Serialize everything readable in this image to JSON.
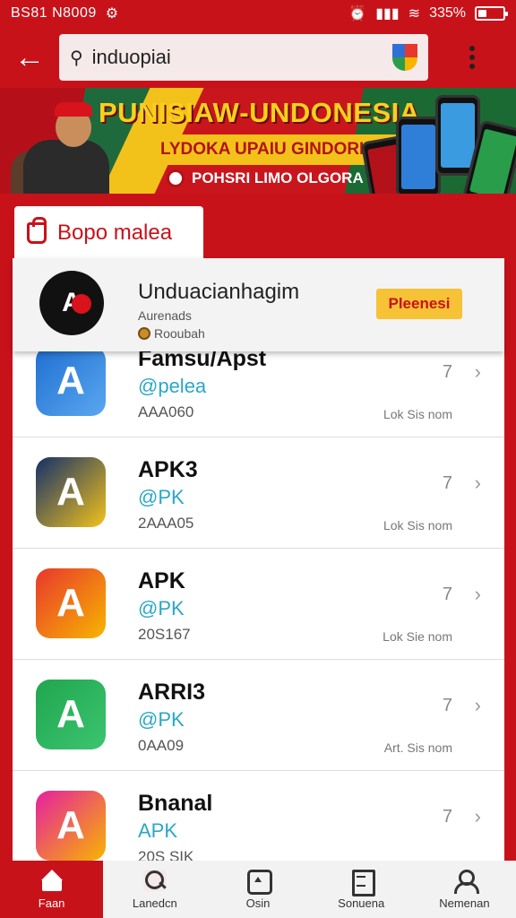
{
  "status_bar": {
    "time": "BS81 N8009",
    "battery": "335%",
    "battery_level": 0.33
  },
  "header": {
    "search_query": "induopiai",
    "back_icon": "arrow-left-icon",
    "menu_icon": "more-vertical-icon"
  },
  "banner": {
    "headline": "PUNISIAW‑UNDONESIA",
    "subline": "LYDOKA UPAIU GINDORKAN",
    "footnote": "POHSRI LIMO OLGORA"
  },
  "section": {
    "label": "Bopo malea"
  },
  "featured": {
    "logo_text": "A",
    "title": "Unduacianhagim",
    "developer": "Aurenads",
    "rating_label": "Rooubah",
    "button_label": "Pleenesi"
  },
  "apps": [
    {
      "name": "Famsu/Apst",
      "publisher": "@pelea",
      "meta": "AAA060",
      "count": "7",
      "size": "Lok Sis nom",
      "icon_name": "app-a-blue-icon",
      "colors": [
        "#1f6fd1",
        "#5aa7f0"
      ]
    },
    {
      "name": "APK3",
      "publisher": "@PK",
      "meta": "2AAA05",
      "count": "7",
      "size": "Lok Sis nom",
      "icon_name": "app-shield-yellow-icon",
      "colors": [
        "#13306a",
        "#f3c21a"
      ]
    },
    {
      "name": "APK",
      "publisher": "@PK",
      "meta": "20S167",
      "count": "7",
      "size": "Lok Sie nom",
      "icon_name": "app-play-gradient-icon",
      "colors": [
        "#e8372d",
        "#f7b500"
      ]
    },
    {
      "name": "ARRI3",
      "publisher": "@PK",
      "meta": "0AA09",
      "count": "7",
      "size": "Art. Sis nom",
      "icon_name": "app-a-green-icon",
      "colors": [
        "#1fa64e",
        "#3dc470"
      ]
    },
    {
      "name": "Bnanal",
      "publisher": "APK",
      "meta": "20S SIK",
      "count": "7",
      "size": "",
      "icon_name": "app-a-rainbow-icon",
      "colors": [
        "#e61fa0",
        "#f7b500"
      ]
    }
  ],
  "nav": [
    {
      "label": "Faan",
      "icon": "home-icon",
      "active": true
    },
    {
      "label": "Lanedcn",
      "icon": "search-icon",
      "active": false
    },
    {
      "label": "Osin",
      "icon": "app-store-icon",
      "active": false
    },
    {
      "label": "Sonuena",
      "icon": "document-icon",
      "active": false
    },
    {
      "label": "Nemenan",
      "icon": "user-icon",
      "active": false
    }
  ]
}
